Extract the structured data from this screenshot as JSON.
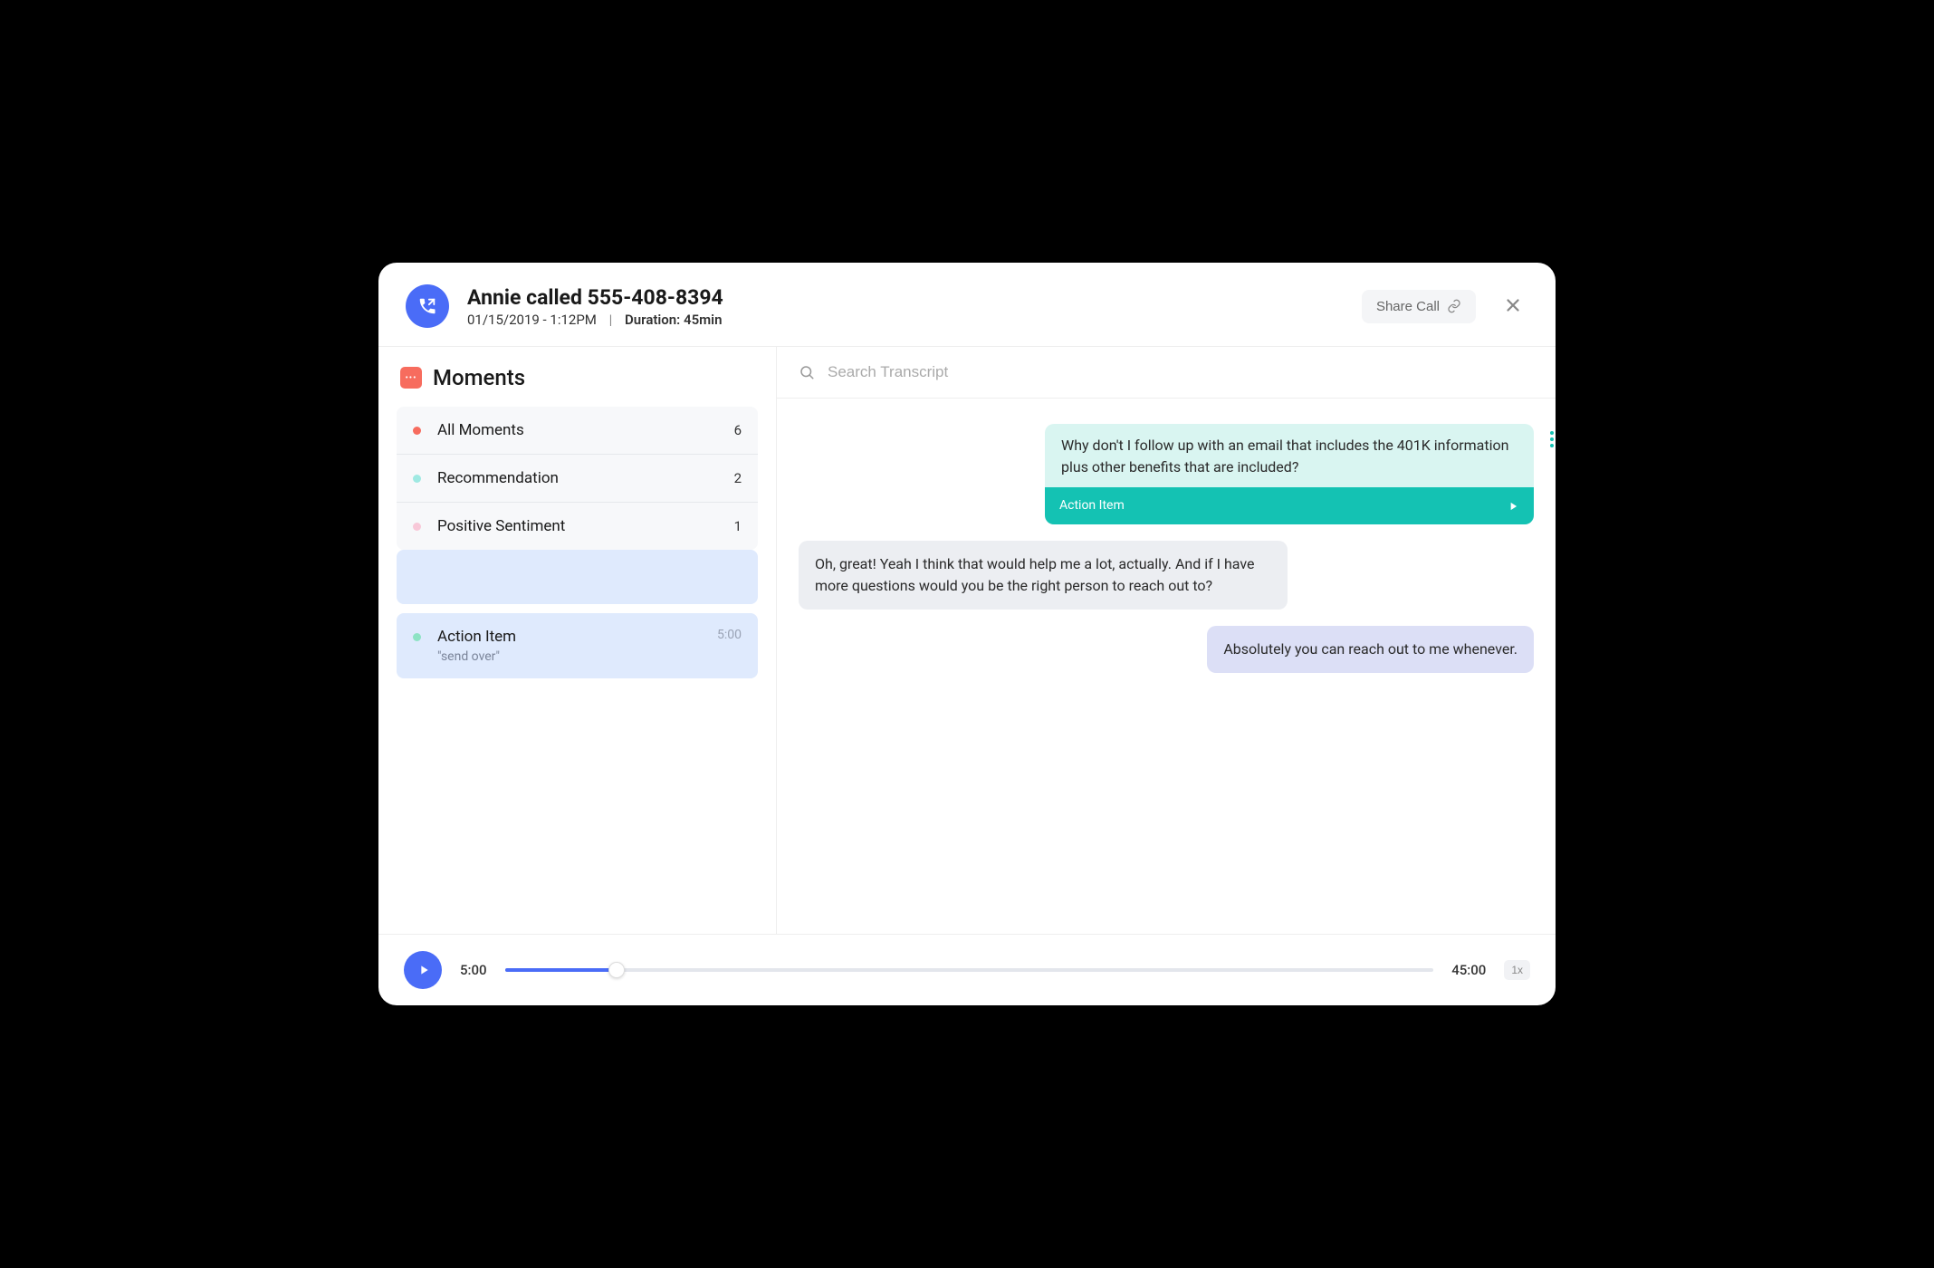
{
  "header": {
    "title": "Annie called 555-408-8394",
    "datetime": "01/15/2019 - 1:12PM",
    "duration_label": "Duration:",
    "duration_value": "45min",
    "share_label": "Share Call"
  },
  "sidebar": {
    "title": "Moments",
    "filters": [
      {
        "label": "All Moments",
        "count": "6",
        "dot": "red"
      },
      {
        "label": "Recommendation",
        "count": "2",
        "dot": "cyan"
      },
      {
        "label": "Positive Sentiment",
        "count": "1",
        "dot": "pink"
      }
    ],
    "action_item": {
      "label": "Action Item",
      "quote": "\"send over\"",
      "time": "5:00"
    }
  },
  "search": {
    "placeholder": "Search Transcript"
  },
  "transcript": {
    "msg1": "Why don't I follow up with an email that includes the 401K information plus other benefits that are included?",
    "msg1_tag": "Action Item",
    "msg2": "Oh, great! Yeah I think that would help me a lot, actually. And if I have more questions would you be the right person to reach out to?",
    "msg3": "Absolutely you can reach out to me whenever."
  },
  "player": {
    "current": "5:00",
    "total": "45:00",
    "speed": "1x"
  }
}
